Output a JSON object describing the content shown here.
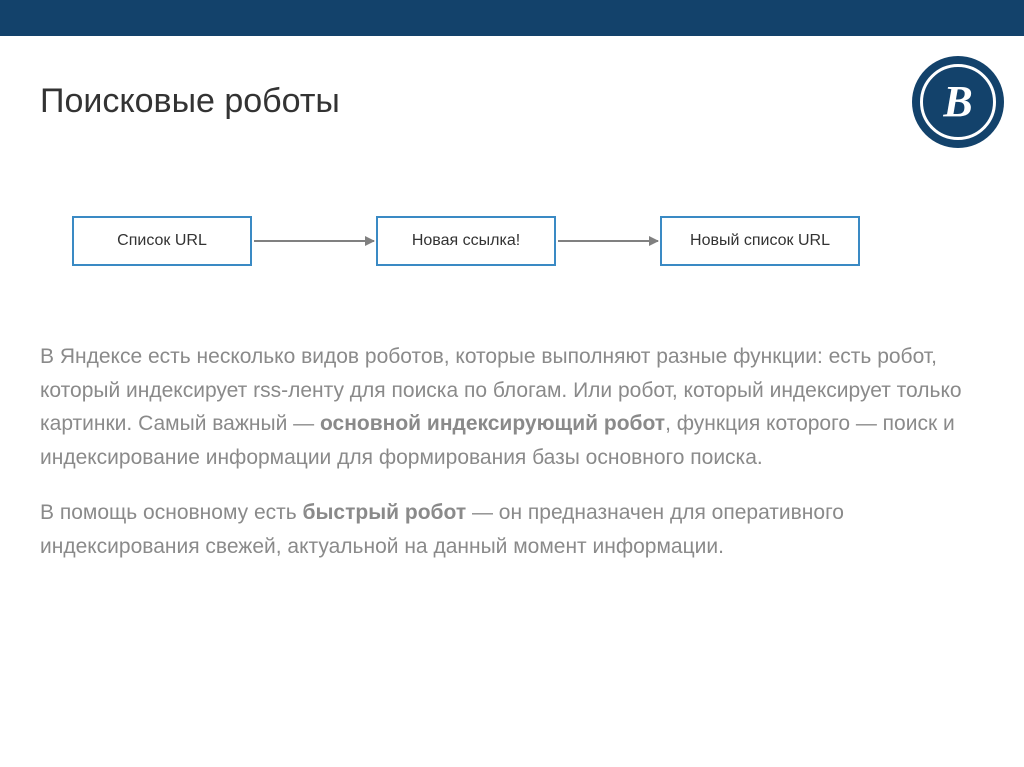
{
  "title": "Поисковые роботы",
  "logo": {
    "letter": "В"
  },
  "diagram": {
    "box1": "Список URL",
    "box2": "Новая ссылка!",
    "box3": "Новый список URL"
  },
  "paragraphs": {
    "p1_before": "В Яндексе есть несколько видов роботов, которые выполняют разные функции: есть робот, который индексирует rss-ленту для поиска по блогам. Или робот, который индексирует только картинки. Самый важный — ",
    "p1_bold": "основной индексирующий робот",
    "p1_after": ", функция которого — поиск и индексирование информации для формирования базы основного поиска.",
    "p2_before": "В помощь основному есть ",
    "p2_bold": "быстрый робот",
    "p2_after": " — он предназначен для оперативного индексирования свежей, актуальной на данный момент информации."
  }
}
